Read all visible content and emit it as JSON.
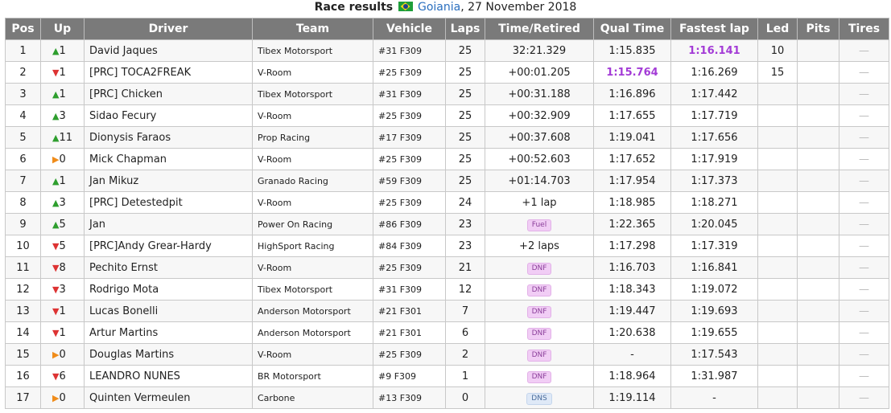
{
  "caption": {
    "label": "Race results",
    "city": "Goiania",
    "date": ", 27 November 2018"
  },
  "headers": [
    "Pos",
    "Up",
    "Driver",
    "Team",
    "Vehicle",
    "Laps",
    "Time/Retired",
    "Qual Time",
    "Fastest lap",
    "Led",
    "Pits",
    "Tires"
  ],
  "rows": [
    {
      "pos": "1",
      "up_dir": "up",
      "up": "1",
      "driver": "David Jaques",
      "team": "Tibex Motorsport",
      "vehicle": "#31 F309",
      "laps": "25",
      "time": "32:21.329",
      "time_badge": "",
      "qual": "1:15.835",
      "qual_best": false,
      "fastest": "1:16.141",
      "fastest_best": true,
      "led": "10"
    },
    {
      "pos": "2",
      "up_dir": "down",
      "up": "1",
      "driver": "[PRC] TOCA2FREAK",
      "team": "V-Room",
      "vehicle": "#25 F309",
      "laps": "25",
      "time": "+00:01.205",
      "time_badge": "",
      "qual": "1:15.764",
      "qual_best": true,
      "fastest": "1:16.269",
      "fastest_best": false,
      "led": "15"
    },
    {
      "pos": "3",
      "up_dir": "up",
      "up": "1",
      "driver": "[PRC] Chicken",
      "team": "Tibex Motorsport",
      "vehicle": "#31 F309",
      "laps": "25",
      "time": "+00:31.188",
      "time_badge": "",
      "qual": "1:16.896",
      "qual_best": false,
      "fastest": "1:17.442",
      "fastest_best": false,
      "led": ""
    },
    {
      "pos": "4",
      "up_dir": "up",
      "up": "3",
      "driver": "Sidao Fecury",
      "team": "V-Room",
      "vehicle": "#25 F309",
      "laps": "25",
      "time": "+00:32.909",
      "time_badge": "",
      "qual": "1:17.655",
      "qual_best": false,
      "fastest": "1:17.719",
      "fastest_best": false,
      "led": ""
    },
    {
      "pos": "5",
      "up_dir": "up",
      "up": "11",
      "driver": "Dionysis Faraos",
      "team": "Prop Racing",
      "vehicle": "#17 F309",
      "laps": "25",
      "time": "+00:37.608",
      "time_badge": "",
      "qual": "1:19.041",
      "qual_best": false,
      "fastest": "1:17.656",
      "fastest_best": false,
      "led": ""
    },
    {
      "pos": "6",
      "up_dir": "same",
      "up": "0",
      "driver": "Mick Chapman",
      "team": "V-Room",
      "vehicle": "#25 F309",
      "laps": "25",
      "time": "+00:52.603",
      "time_badge": "",
      "qual": "1:17.652",
      "qual_best": false,
      "fastest": "1:17.919",
      "fastest_best": false,
      "led": ""
    },
    {
      "pos": "7",
      "up_dir": "up",
      "up": "1",
      "driver": "Jan Mikuz",
      "team": "Granado Racing",
      "vehicle": "#59 F309",
      "laps": "25",
      "time": "+01:14.703",
      "time_badge": "",
      "qual": "1:17.954",
      "qual_best": false,
      "fastest": "1:17.373",
      "fastest_best": false,
      "led": ""
    },
    {
      "pos": "8",
      "up_dir": "up",
      "up": "3",
      "driver": "[PRC] Detestedpit",
      "team": "V-Room",
      "vehicle": "#25 F309",
      "laps": "24",
      "time": "+1 lap",
      "time_badge": "",
      "qual": "1:18.985",
      "qual_best": false,
      "fastest": "1:18.271",
      "fastest_best": false,
      "led": ""
    },
    {
      "pos": "9",
      "up_dir": "up",
      "up": "5",
      "driver": "Jan",
      "team": "Power On Racing",
      "vehicle": "#86 F309",
      "laps": "23",
      "time": "",
      "time_badge": "Fuel",
      "qual": "1:22.365",
      "qual_best": false,
      "fastest": "1:20.045",
      "fastest_best": false,
      "led": ""
    },
    {
      "pos": "10",
      "up_dir": "down",
      "up": "5",
      "driver": "[PRC]Andy Grear-Hardy",
      "team": "HighSport Racing",
      "vehicle": "#84 F309",
      "laps": "23",
      "time": "+2 laps",
      "time_badge": "",
      "qual": "1:17.298",
      "qual_best": false,
      "fastest": "1:17.319",
      "fastest_best": false,
      "led": ""
    },
    {
      "pos": "11",
      "up_dir": "down",
      "up": "8",
      "driver": "Pechito Ernst",
      "team": "V-Room",
      "vehicle": "#25 F309",
      "laps": "21",
      "time": "",
      "time_badge": "DNF",
      "qual": "1:16.703",
      "qual_best": false,
      "fastest": "1:16.841",
      "fastest_best": false,
      "led": ""
    },
    {
      "pos": "12",
      "up_dir": "down",
      "up": "3",
      "driver": "Rodrigo Mota",
      "team": "Tibex Motorsport",
      "vehicle": "#31 F309",
      "laps": "12",
      "time": "",
      "time_badge": "DNF",
      "qual": "1:18.343",
      "qual_best": false,
      "fastest": "1:19.072",
      "fastest_best": false,
      "led": ""
    },
    {
      "pos": "13",
      "up_dir": "down",
      "up": "1",
      "driver": "Lucas Bonelli",
      "team": "Anderson Motorsport",
      "vehicle": "#21 F301",
      "laps": "7",
      "time": "",
      "time_badge": "DNF",
      "qual": "1:19.447",
      "qual_best": false,
      "fastest": "1:19.693",
      "fastest_best": false,
      "led": ""
    },
    {
      "pos": "14",
      "up_dir": "down",
      "up": "1",
      "driver": "Artur Martins",
      "team": "Anderson Motorsport",
      "vehicle": "#21 F301",
      "laps": "6",
      "time": "",
      "time_badge": "DNF",
      "qual": "1:20.638",
      "qual_best": false,
      "fastest": "1:19.655",
      "fastest_best": false,
      "led": ""
    },
    {
      "pos": "15",
      "up_dir": "same",
      "up": "0",
      "driver": "Douglas Martins",
      "team": "V-Room",
      "vehicle": "#25 F309",
      "laps": "2",
      "time": "",
      "time_badge": "DNF",
      "qual": "-",
      "qual_best": false,
      "fastest": "1:17.543",
      "fastest_best": false,
      "led": ""
    },
    {
      "pos": "16",
      "up_dir": "down",
      "up": "6",
      "driver": "LEANDRO NUNES",
      "team": "BR Motorsport",
      "vehicle": "#9 F309",
      "laps": "1",
      "time": "",
      "time_badge": "DNF",
      "qual": "1:18.964",
      "qual_best": false,
      "fastest": "1:31.987",
      "fastest_best": false,
      "led": ""
    },
    {
      "pos": "17",
      "up_dir": "same",
      "up": "0",
      "driver": "Quinten Vermeulen",
      "team": "Carbone",
      "vehicle": "#13 F309",
      "laps": "0",
      "time": "",
      "time_badge": "DNS",
      "qual": "1:19.114",
      "qual_best": false,
      "fastest": "-",
      "fastest_best": false,
      "led": ""
    }
  ],
  "tires_placeholder": "—",
  "arrow_glyphs": {
    "up": "▲",
    "down": "▼",
    "same": "▶"
  }
}
